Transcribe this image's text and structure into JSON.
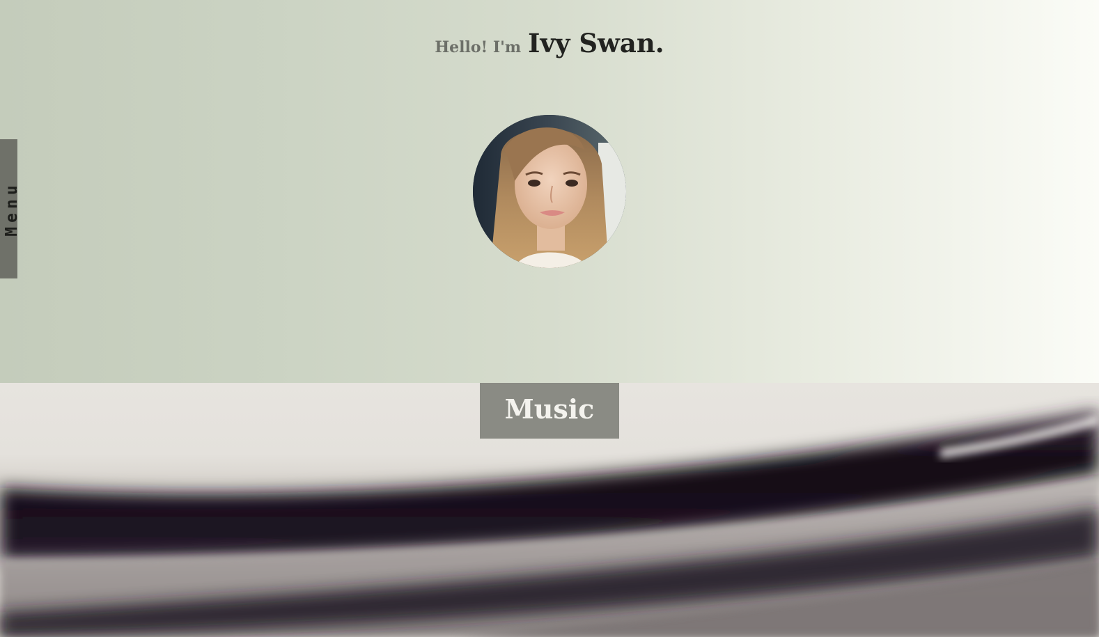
{
  "hero": {
    "greeting_prefix": "Hello! I'm",
    "name": "Ivy Swan.",
    "avatar_alt": "profile photo"
  },
  "menu": {
    "label": "Menu"
  },
  "sections": {
    "music_label": "Music"
  },
  "colors": {
    "menu_tab": "#6f7169",
    "music_button": "#8a8b84",
    "name_text": "#222320"
  }
}
